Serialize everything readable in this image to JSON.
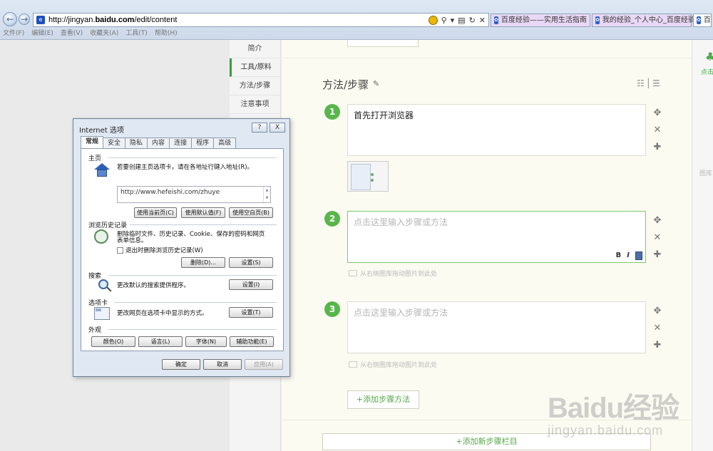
{
  "browser": {
    "url_prefix": "http://jingyan.",
    "url_domain": "baidu.com",
    "url_path": "/edit/content",
    "tabs": [
      {
        "title": "百度经验——实用生活指南"
      },
      {
        "title": "我的经验_个人中心_百度经验"
      },
      {
        "title": "百"
      }
    ],
    "menu": [
      "文件(F)",
      "编辑(E)",
      "查看(V)",
      "收藏夹(A)",
      "工具(T)",
      "帮助(H)"
    ],
    "back_glyph": "←",
    "forward_glyph": "→"
  },
  "side_nav": {
    "items": [
      {
        "label": "简介"
      },
      {
        "label": "工具/原料"
      },
      {
        "label": "方法/步骤"
      },
      {
        "label": "注意事项"
      }
    ]
  },
  "editor": {
    "section_title": "方法/步骤",
    "steps": [
      {
        "number": "1",
        "text": "首先打开浏览器"
      },
      {
        "number": "2",
        "placeholder": "点击这里输入步骤或方法"
      },
      {
        "number": "3",
        "placeholder": "点击这里输入步骤或方法"
      }
    ],
    "drag_hint": "从右侧图库拖动图片到此处",
    "format_bold": "B",
    "format_italic": "I",
    "add_step_label": "+添加步骤方法",
    "add_section_label": "+添加新步骤栏目"
  },
  "right_panel": {
    "label": "点击",
    "gallery": "图库"
  },
  "watermark": {
    "logo": "Baidu经验",
    "url": "jingyan.baidu.com"
  },
  "dialog": {
    "title": "Internet 选项",
    "help_btn": "?",
    "close_btn": "X",
    "tabs": [
      "常规",
      "安全",
      "隐私",
      "内容",
      "连接",
      "程序",
      "高级"
    ],
    "home": {
      "label": "主页",
      "desc": "若要创建主页选项卡，请在各地址行键入地址(R)。",
      "url": "http://www.hefeishi.com/zhuye",
      "btn_current": "使用当前页(C)",
      "btn_default": "使用默认值(F)",
      "btn_blank": "使用空白页(B)"
    },
    "history": {
      "label": "浏览历史记录",
      "desc_line1": "删除临时文件、历史记录、Cookie、保存的密码和网页",
      "desc_line2": "表单信息。",
      "checkbox": "退出时删除浏览历史记录(W)",
      "btn_delete": "删除(D)...",
      "btn_settings": "设置(S)"
    },
    "search": {
      "label": "搜索",
      "desc": "更改默认的搜索提供程序。",
      "btn_settings": "设置(I)"
    },
    "tabs_group": {
      "label": "选项卡",
      "desc": "更改网页在选项卡中显示的方式。",
      "btn_settings": "设置(T)"
    },
    "appearance": {
      "label": "外观",
      "btn_colors": "颜色(O)",
      "btn_languages": "语言(L)",
      "btn_fonts": "字体(N)",
      "btn_accessibility": "辅助功能(E)"
    },
    "btn_ok": "确定",
    "btn_cancel": "取消",
    "btn_apply": "应用(A)"
  }
}
